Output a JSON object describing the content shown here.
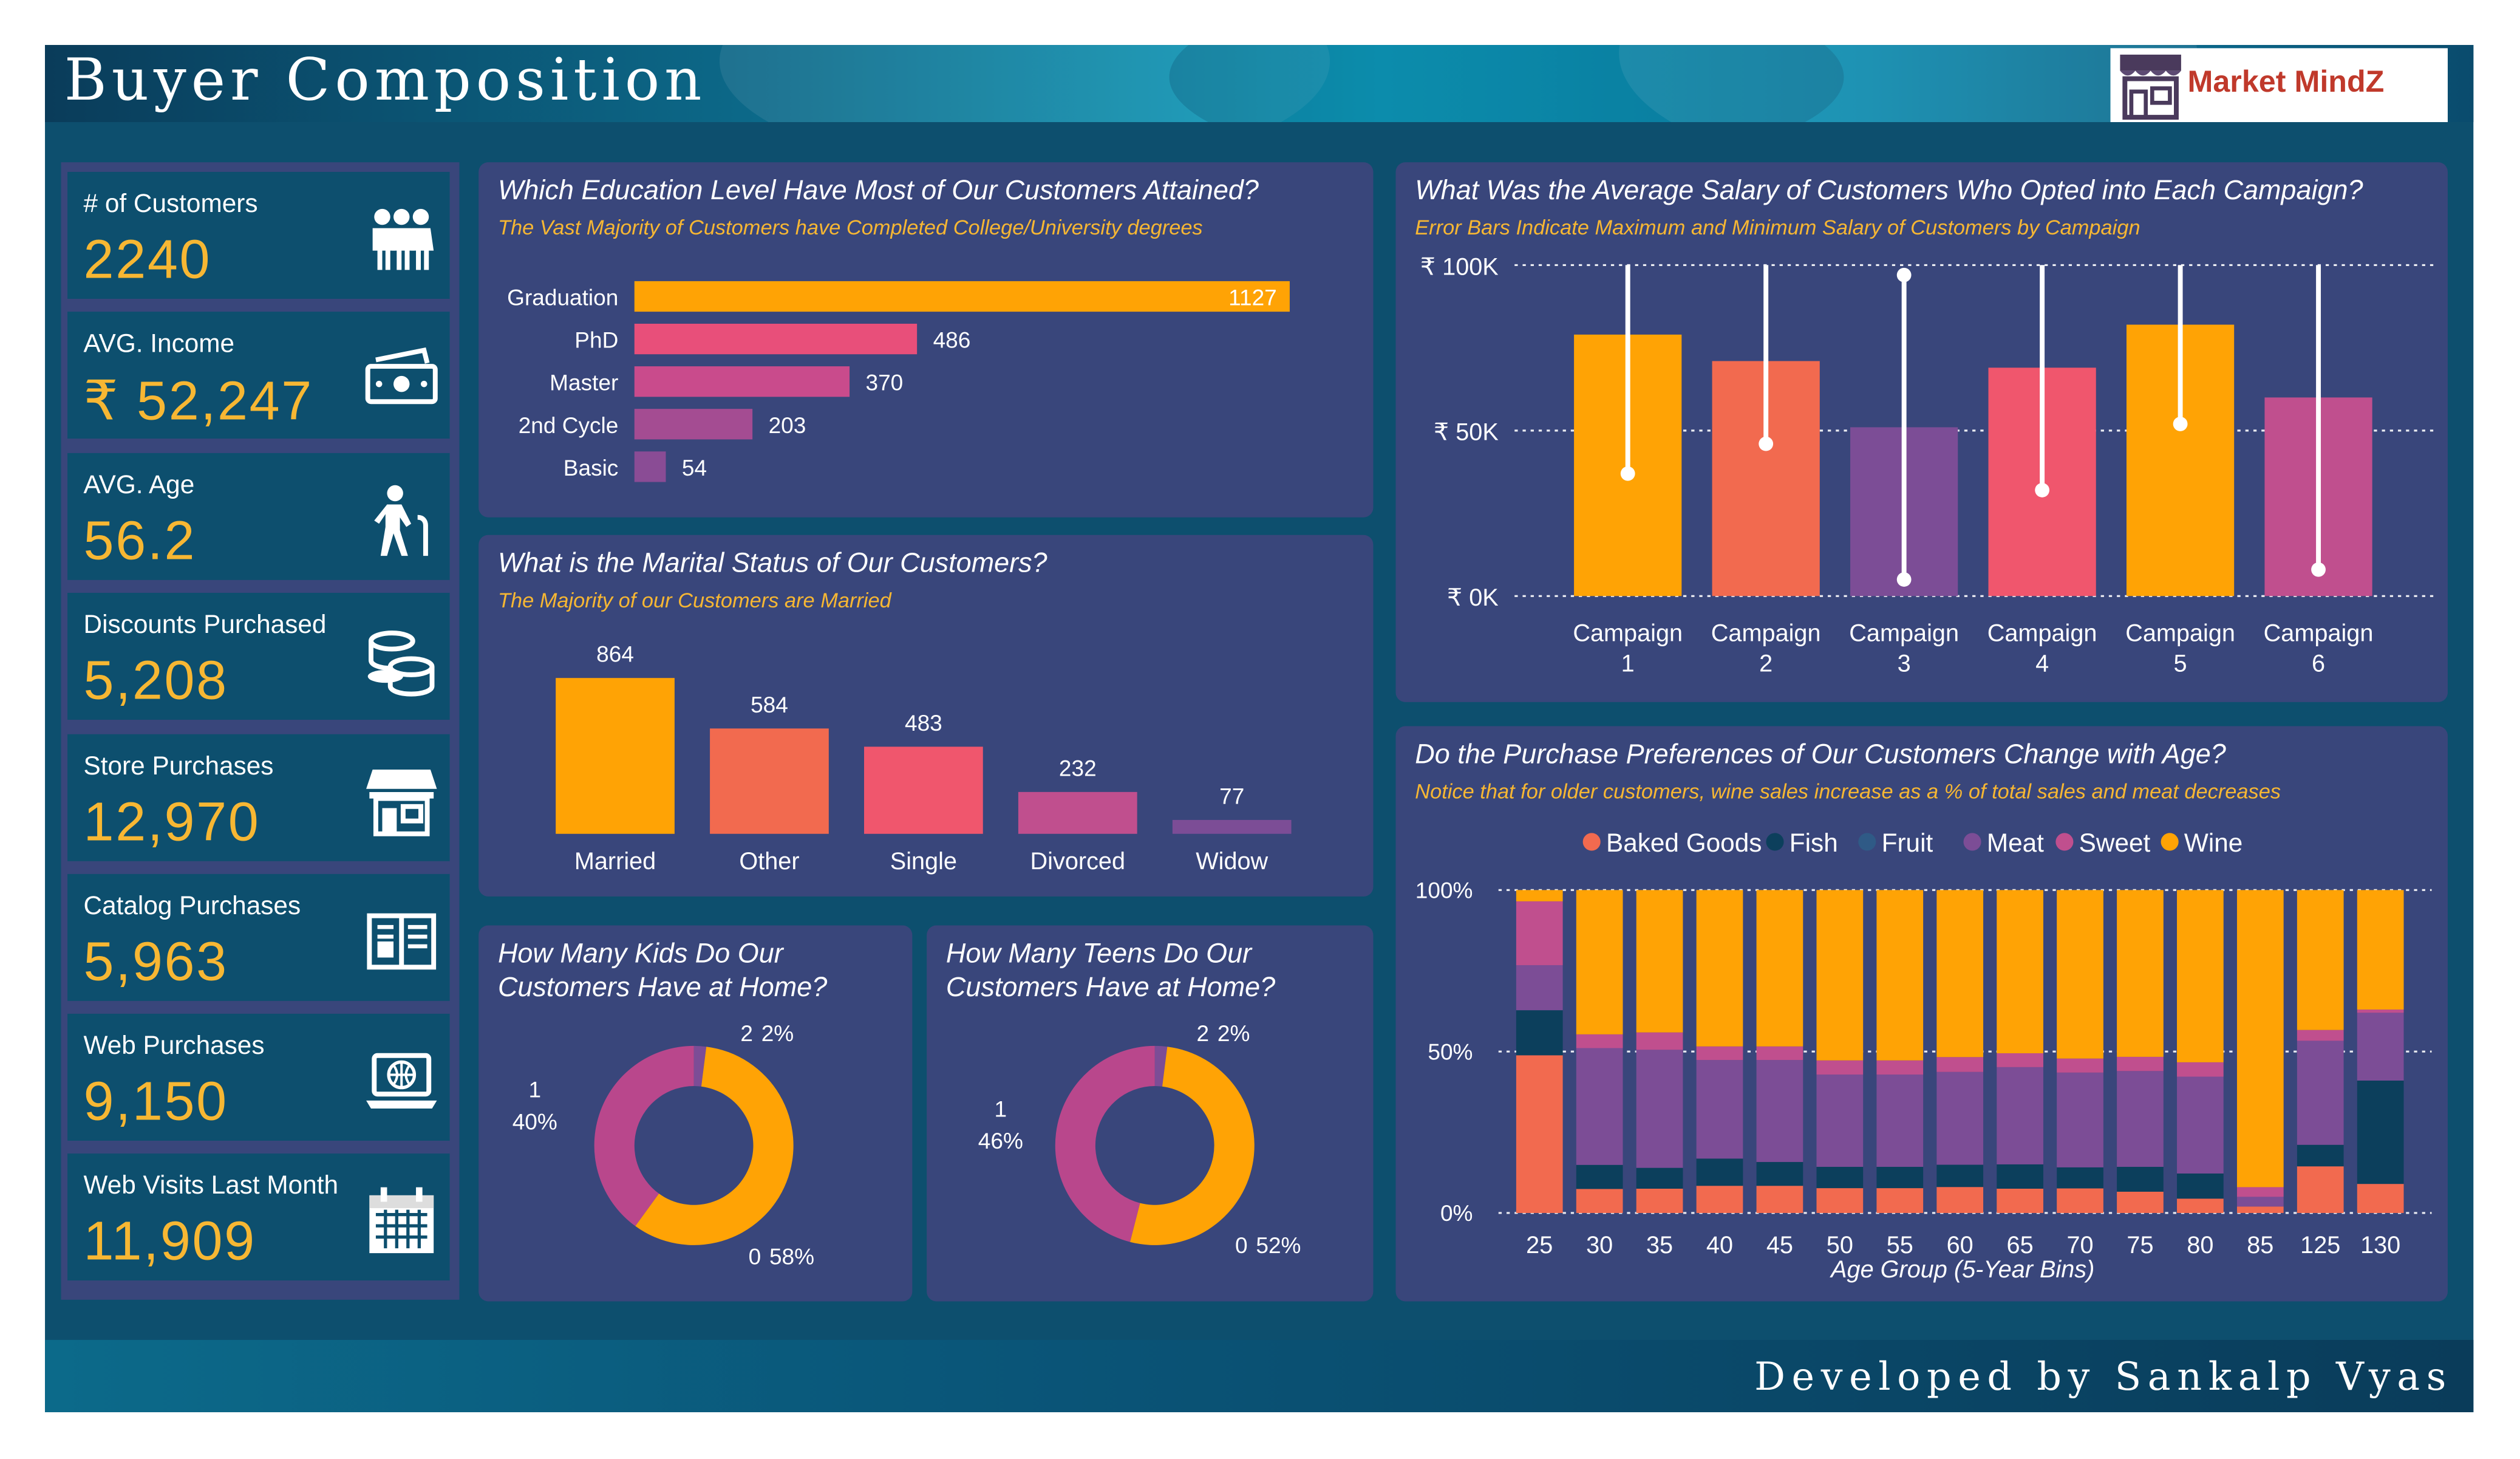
{
  "header": {
    "title": "Buyer Composition",
    "logo_text": "Market MindZ"
  },
  "footer": {
    "credit": "Developed by Sankalp Vyas"
  },
  "kpis": [
    {
      "label": "# of Customers",
      "value": "2240",
      "icon": "people-icon"
    },
    {
      "label": "AVG. Income",
      "value": "₹ 52,247",
      "icon": "money-icon"
    },
    {
      "label": "AVG. Age",
      "value": "56.2",
      "icon": "elderly-person-icon"
    },
    {
      "label": "Discounts Purchased",
      "value": "5,208",
      "icon": "coins-icon"
    },
    {
      "label": "Store Purchases",
      "value": "12,970",
      "icon": "store-icon"
    },
    {
      "label": "Catalog Purchases",
      "value": "5,963",
      "icon": "book-icon"
    },
    {
      "label": "Web Purchases",
      "value": "9,150",
      "icon": "laptop-globe-icon"
    },
    {
      "label": "Web Visits Last Month",
      "value": "11,909",
      "icon": "calendar-icon"
    }
  ],
  "colors": {
    "orange": "#ffa305",
    "coral": "#f26a4f",
    "pink": "#f0566d",
    "magenta": "#c04f8e",
    "purple": "#7c4d96",
    "gold": "#f7b733",
    "navy": "#0d4f6e",
    "panel": "#39467b"
  },
  "education": {
    "title": "Which Education Level Have Most of Our Customers Attained?",
    "subtitle": "The Vast Majority of Customers have Completed College/University degrees"
  },
  "marital": {
    "title": "What is the Marital Status of Our Customers?",
    "subtitle": "The Majority of our Customers are Married"
  },
  "kids": {
    "title_line1": "How Many Kids Do Our",
    "title_line2": "Customers Have at Home?"
  },
  "teens": {
    "title_line1": "How Many Teens Do Our",
    "title_line2": "Customers Have at Home?"
  },
  "salary": {
    "title": "What Was the Average Salary of Customers Who Opted into Each Campaign?",
    "subtitle": "Error Bars Indicate Maximum and Minimum Salary of Customers by Campaign"
  },
  "age": {
    "title": "Do the Purchase Preferences of Our Customers Change with Age?",
    "subtitle": "Notice that for older customers, wine sales increase as a % of total sales and meat decreases"
  },
  "chart_data": [
    {
      "id": "education",
      "type": "bar",
      "orientation": "horizontal",
      "categories": [
        "Graduation",
        "PhD",
        "Master",
        "2nd Cycle",
        "Basic"
      ],
      "values": [
        1127,
        486,
        370,
        203,
        54
      ],
      "colors": [
        "#ffa305",
        "#e84f7a",
        "#c94b8c",
        "#a44c92",
        "#8a4c95"
      ]
    },
    {
      "id": "marital",
      "type": "bar",
      "categories": [
        "Married",
        "Other",
        "Single",
        "Divorced",
        "Widow"
      ],
      "values": [
        864,
        584,
        483,
        232,
        77
      ],
      "colors": [
        "#ffa305",
        "#f26a4f",
        "#f0566d",
        "#c04f8e",
        "#7c4d96"
      ]
    },
    {
      "id": "kids",
      "type": "pie",
      "style": "donut",
      "slices": [
        {
          "label": "0",
          "pct": "58%",
          "value": 58,
          "color": "#ffa305"
        },
        {
          "label": "1",
          "pct": "40%",
          "value": 40,
          "color": "#b9478c"
        },
        {
          "label": "2",
          "pct": "2%",
          "value": 2,
          "color": "#7c4d96"
        }
      ]
    },
    {
      "id": "teens",
      "type": "pie",
      "style": "donut",
      "slices": [
        {
          "label": "0",
          "pct": "52%",
          "value": 52,
          "color": "#ffa305"
        },
        {
          "label": "1",
          "pct": "46%",
          "value": 46,
          "color": "#b9478c"
        },
        {
          "label": "2",
          "pct": "2%",
          "value": 2,
          "color": "#7c4d96"
        }
      ]
    },
    {
      "id": "salary",
      "type": "bar",
      "error_bars": true,
      "categories": [
        [
          "Campaign",
          "1"
        ],
        [
          "Campaign",
          "2"
        ],
        [
          "Campaign",
          "3"
        ],
        [
          "Campaign",
          "4"
        ],
        [
          "Campaign",
          "5"
        ],
        [
          "Campaign",
          "6"
        ]
      ],
      "values": [
        79000,
        71000,
        51000,
        69000,
        82000,
        60000
      ],
      "min": [
        37000,
        46000,
        5000,
        32000,
        52000,
        8000
      ],
      "max": [
        100000,
        100000,
        97000,
        100000,
        100000,
        100000
      ],
      "colors": [
        "#ffa305",
        "#f26a4f",
        "#7c4d96",
        "#f0566d",
        "#ffa305",
        "#c04f8e"
      ],
      "ylim": [
        0,
        100000
      ],
      "yticks": [
        {
          "v": 0,
          "label": "₹ 0K"
        },
        {
          "v": 50000,
          "label": "₹ 50K"
        },
        {
          "v": 100000,
          "label": "₹ 100K"
        }
      ]
    },
    {
      "id": "age",
      "type": "bar",
      "stacked": "percent",
      "xlabel": "Age Group (5-Year Bins)",
      "categories": [
        "25",
        "30",
        "35",
        "40",
        "45",
        "50",
        "55",
        "60",
        "65",
        "70",
        "75",
        "80",
        "85",
        "125",
        "130"
      ],
      "series": [
        {
          "name": "Baked Goods",
          "color": "#f26a4f",
          "values": [
            42,
            7,
            7,
            8,
            8,
            7,
            7,
            7,
            7,
            7,
            6,
            4,
            2,
            13,
            9
          ]
        },
        {
          "name": "Fish",
          "color": "#0c3f5c",
          "values": [
            12,
            7,
            6,
            8,
            7,
            6,
            6,
            6,
            7,
            6,
            7,
            7,
            0,
            6,
            32
          ]
        },
        {
          "name": "Fruit",
          "color": "#2f5a86",
          "values": [
            0,
            0,
            0,
            0,
            0,
            0,
            0,
            0,
            0,
            0,
            0,
            0,
            0,
            0,
            0
          ]
        },
        {
          "name": "Meat",
          "color": "#7c4d96",
          "values": [
            12,
            34,
            34,
            29,
            30,
            26,
            26,
            25,
            28,
            27,
            27,
            27,
            3,
            29,
            21
          ]
        },
        {
          "name": "Sweet",
          "color": "#c04f8e",
          "values": [
            17,
            4,
            5,
            4,
            4,
            4,
            4,
            4,
            4,
            4,
            4,
            4,
            3,
            3,
            1
          ]
        },
        {
          "name": "Wine",
          "color": "#ffa305",
          "values": [
            3,
            42,
            41,
            46,
            46,
            48,
            48,
            45,
            47,
            48,
            47,
            48,
            92,
            39,
            37
          ]
        }
      ],
      "yticks": [
        {
          "v": 0,
          "label": "0%"
        },
        {
          "v": 50,
          "label": "50%"
        },
        {
          "v": 100,
          "label": "100%"
        }
      ]
    }
  ]
}
